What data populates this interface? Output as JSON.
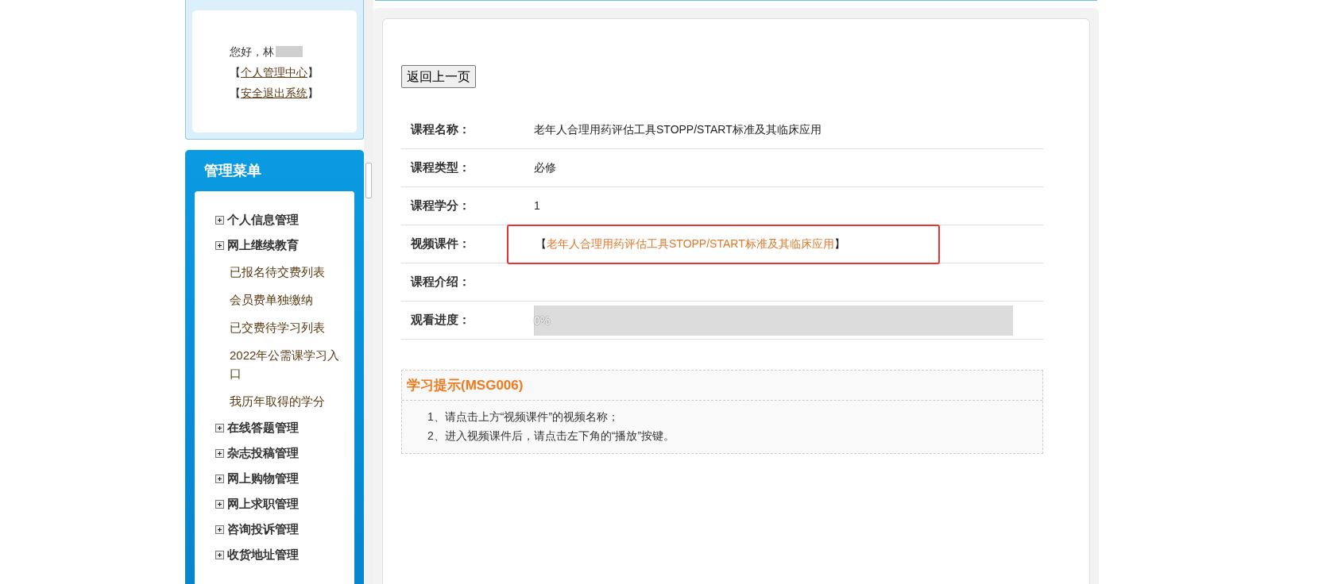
{
  "user_box": {
    "greeting": "您好，林",
    "name_blurred": true,
    "links": [
      {
        "bracket_open": "【",
        "label": "个人管理中心",
        "bracket_close": "】"
      },
      {
        "bracket_open": "【",
        "label": "安全退出系统",
        "bracket_close": "】"
      }
    ]
  },
  "menu": {
    "title": "管理菜单",
    "items": [
      {
        "label": "个人信息管理"
      },
      {
        "label": "网上继续教育",
        "children": [
          {
            "label": "已报名待交费列表"
          },
          {
            "label": "会员费单独缴纳"
          },
          {
            "label": "已交费待学习列表"
          },
          {
            "label": "2022年公需课学习入口"
          },
          {
            "label": "我历年取得的学分"
          }
        ]
      },
      {
        "label": "在线答题管理"
      },
      {
        "label": "杂志投稿管理"
      },
      {
        "label": "网上购物管理"
      },
      {
        "label": "网上求职管理"
      },
      {
        "label": "咨询投诉管理"
      },
      {
        "label": "收货地址管理"
      }
    ]
  },
  "back_button": "返回上一页",
  "details": [
    {
      "kind": "text",
      "label": "课程名称：",
      "value": "老年人合理用药评估工具STOPP/START标准及其临床应用"
    },
    {
      "kind": "text",
      "label": "课程类型：",
      "value": "必修"
    },
    {
      "kind": "text",
      "label": "课程学分：",
      "value": "1"
    },
    {
      "kind": "link",
      "label": "视频课件：",
      "bracket_open": "【",
      "value": "老年人合理用药评估工具STOPP/START标准及其临床应用",
      "bracket_close": "】",
      "highlighted": true
    },
    {
      "kind": "text",
      "label": "课程介绍："
    },
    {
      "kind": "progress",
      "label": "观看进度：",
      "level": 0,
      "reading": "0%"
    }
  ],
  "tips": {
    "title": "学习提示(MSG006)",
    "lines": [
      "1、请点击上方“视频课件”的视频名称；",
      "2、进入视频课件后，请点击左下角的“播放”按键。"
    ]
  }
}
